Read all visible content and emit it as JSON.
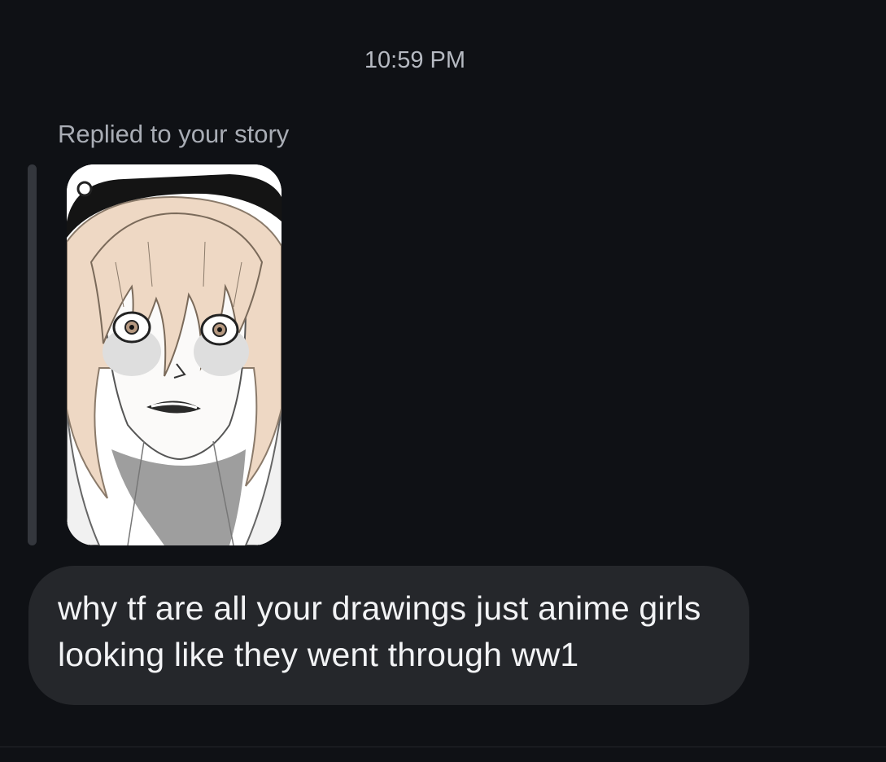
{
  "thread": {
    "timestamp": "10:59 PM"
  },
  "message": {
    "reply_context": "Replied to your story",
    "text": "why tf are all your drawings just anime girls looking like they went through ww1"
  },
  "colors": {
    "background": "#0f1115",
    "bubble": "#25272b",
    "reply_bar": "#34373d",
    "text": "#f2f3f5",
    "secondary_text": "#a9adb5"
  }
}
